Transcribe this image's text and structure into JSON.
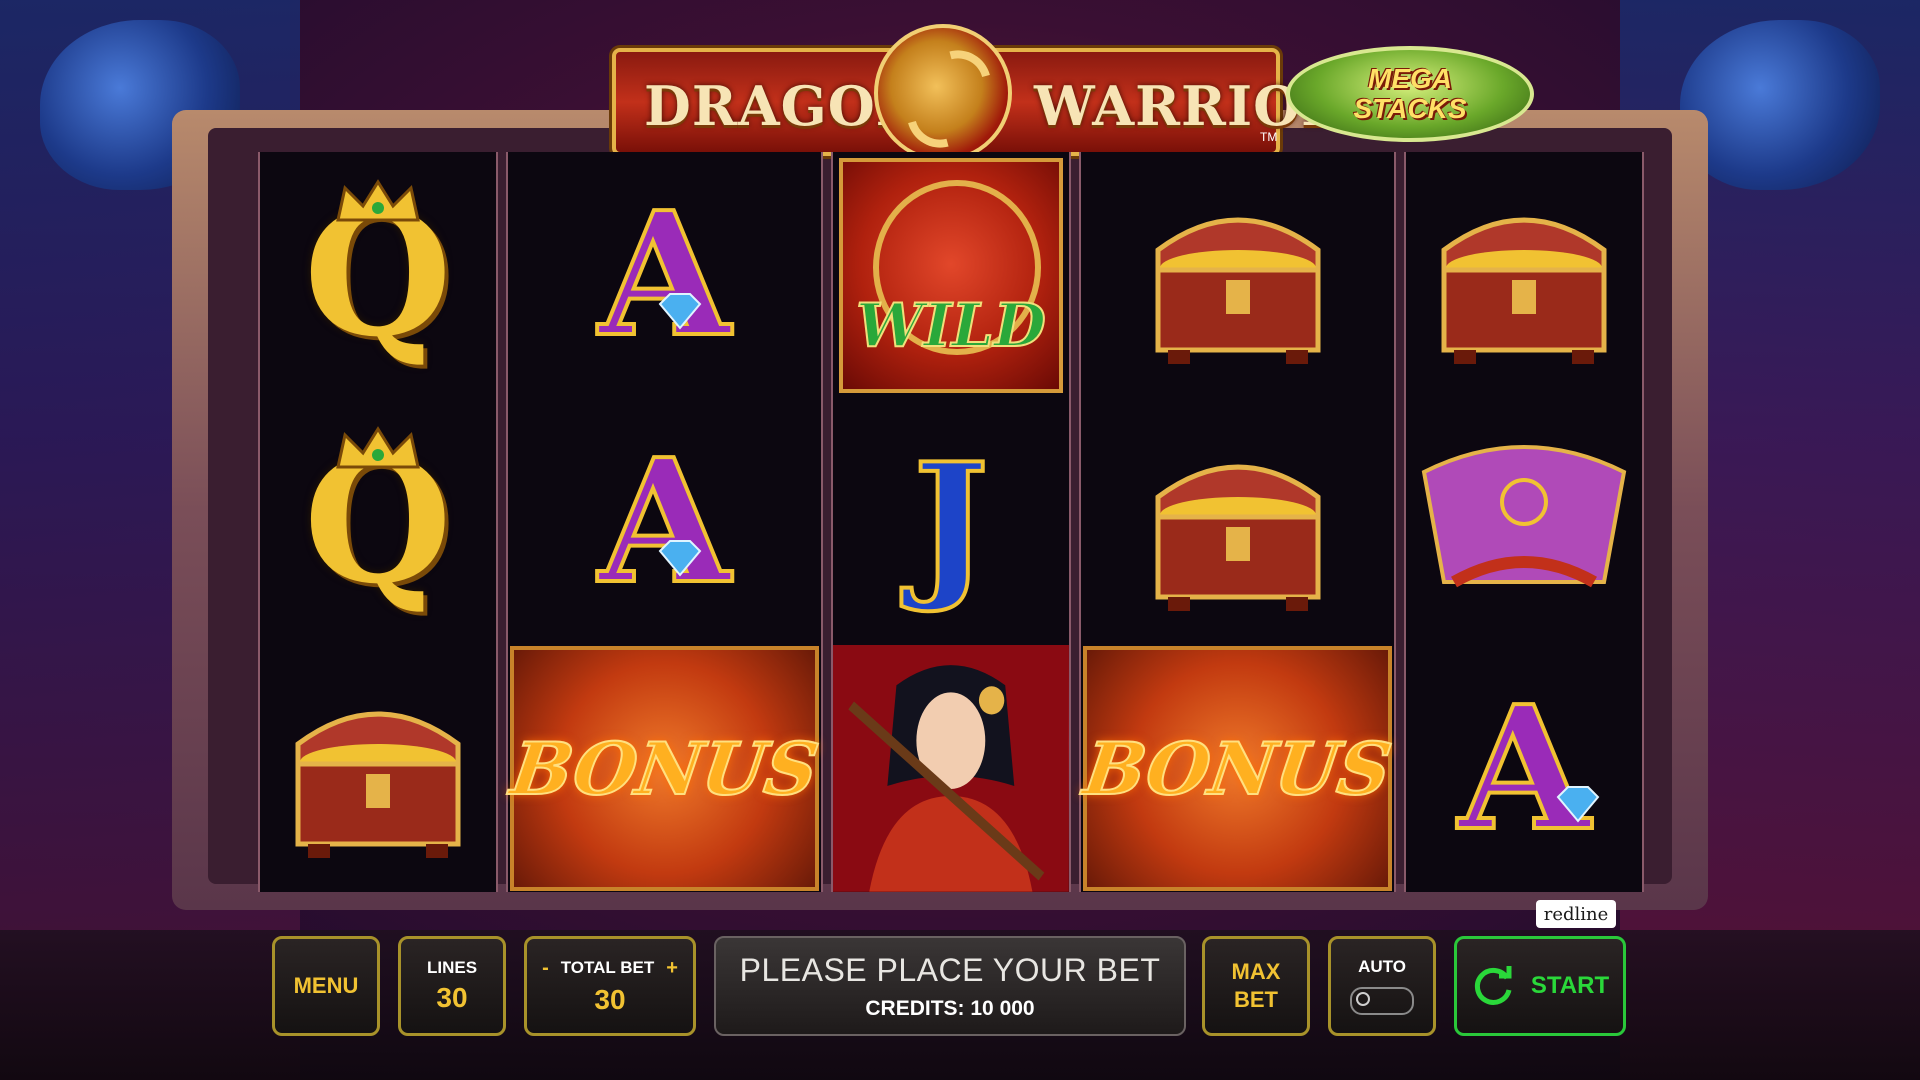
{
  "game": {
    "title_word_1": "DRAGON",
    "title_word_2": "WARRIOR",
    "trademark": "TM",
    "badge_line_1": "MEGA",
    "badge_line_2": "STACKS",
    "provider": "redline"
  },
  "reels": [
    [
      "queen",
      "queen",
      "treasure-chest"
    ],
    [
      "ace",
      "ace",
      "bonus"
    ],
    [
      "wild",
      "jack",
      "warrior"
    ],
    [
      "treasure-chest",
      "treasure-chest",
      "bonus"
    ],
    [
      "treasure-chest",
      "fan",
      "ace"
    ]
  ],
  "symbols": {
    "queen": "Q",
    "ace": "A",
    "jack": "J",
    "wild": "WILD",
    "bonus": "BONUS"
  },
  "controls": {
    "menu_label": "MENU",
    "lines_label": "LINES",
    "lines_value": "30",
    "total_bet_label": "TOTAL BET",
    "bet_minus": "-",
    "bet_plus": "+",
    "total_bet_value": "30",
    "message": "PLEASE PLACE YOUR BET",
    "credits_text": "CREDITS: 10 000",
    "max_bet_line_1": "MAX",
    "max_bet_line_2": "BET",
    "auto_label": "AUTO",
    "start_label": "START"
  },
  "colors": {
    "accent_gold": "#f1c232",
    "start_green": "#2ad83a"
  }
}
